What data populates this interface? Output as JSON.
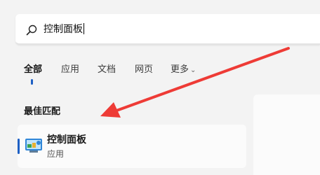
{
  "search": {
    "query": "控制面板"
  },
  "tabs": [
    {
      "label": "全部",
      "active": true
    },
    {
      "label": "应用"
    },
    {
      "label": "文档"
    },
    {
      "label": "网页"
    },
    {
      "label": "更多"
    }
  ],
  "results": {
    "section_title": "最佳匹配",
    "best_match": {
      "title": "控制面板",
      "subtitle": "应用",
      "icon": "control-panel-icon"
    }
  },
  "annotation": {
    "arrow_color": "#ee3b36"
  },
  "colors": {
    "accent": "#1d5fc4"
  }
}
